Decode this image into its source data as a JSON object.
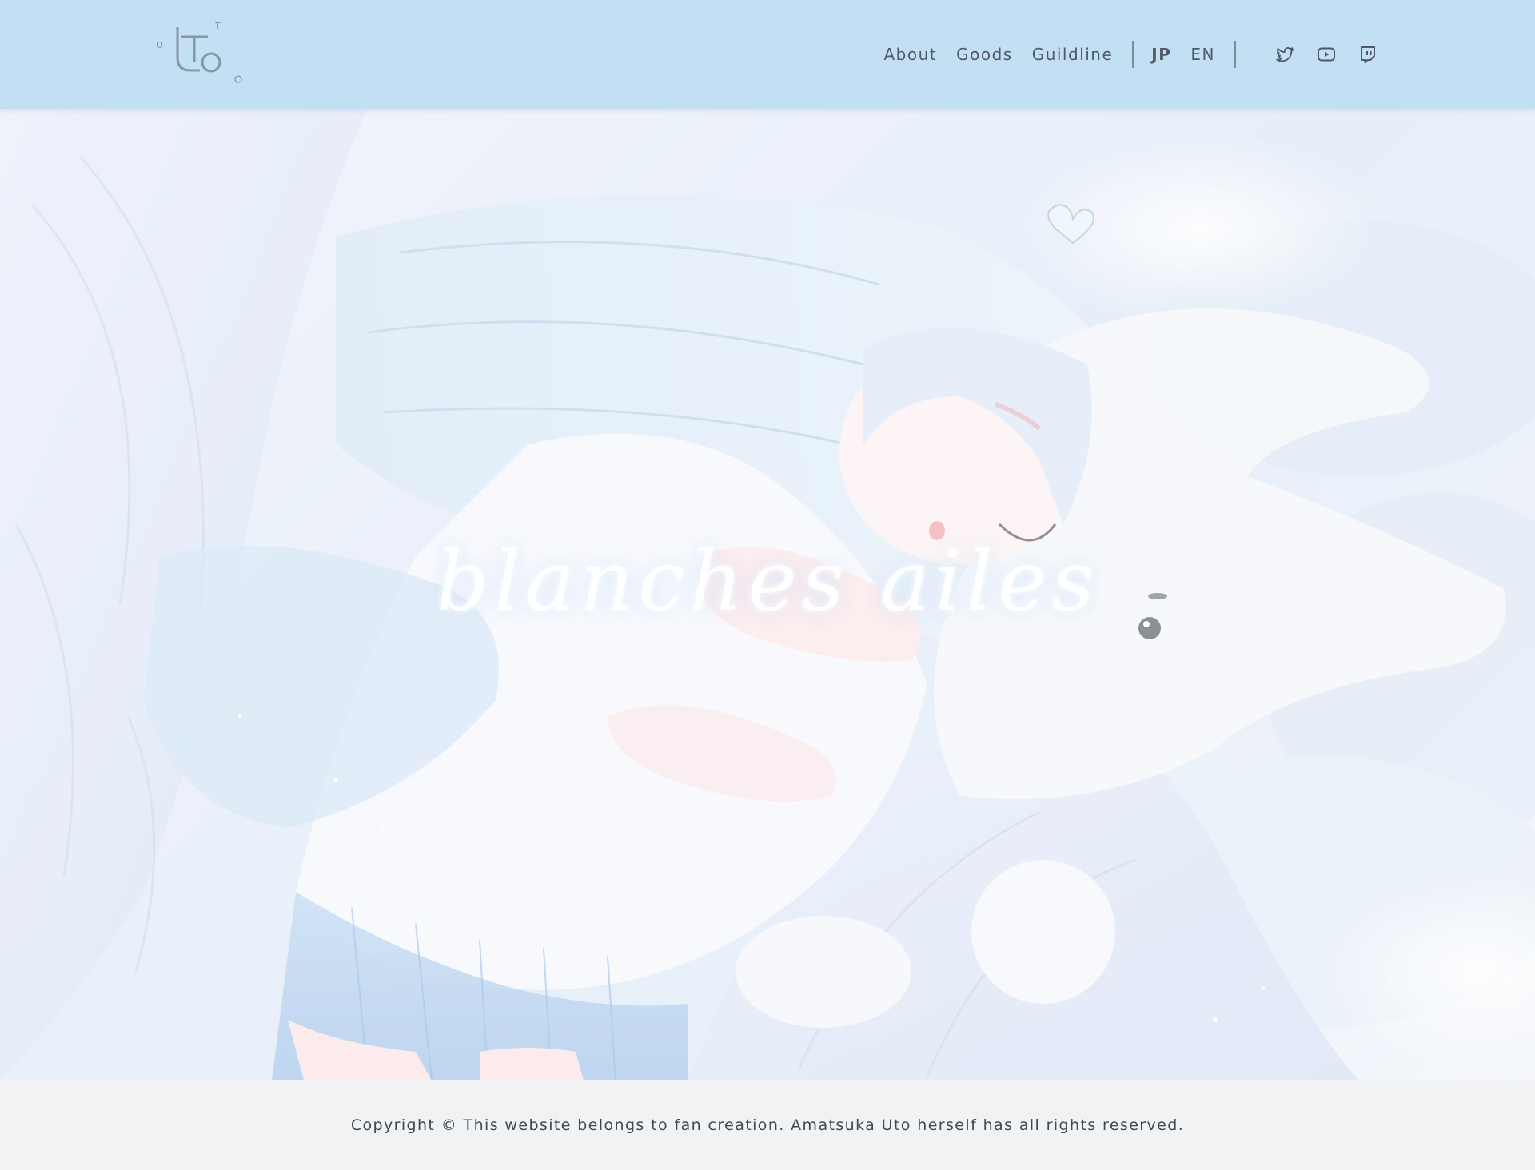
{
  "header": {
    "logo": {
      "letters": [
        "U",
        "T",
        "O"
      ],
      "mark": "Uto"
    },
    "nav": [
      {
        "label": "About"
      },
      {
        "label": "Goods"
      },
      {
        "label": "Guildline"
      }
    ],
    "languages": [
      {
        "label": "JP",
        "active": true
      },
      {
        "label": "EN",
        "active": false
      }
    ],
    "social": [
      {
        "icon": "twitter-icon"
      },
      {
        "icon": "youtube-icon"
      },
      {
        "icon": "twitch-icon"
      }
    ]
  },
  "hero": {
    "title": "blanches ailes"
  },
  "footer": {
    "copyright": "Copyright © This website belongs to fan creation. Amatsuka Uto herself has all rights reserved."
  },
  "colors": {
    "header_bg": "#c2dff3",
    "text": "#4f5a66",
    "footer_bg": "#f1f2f4"
  }
}
